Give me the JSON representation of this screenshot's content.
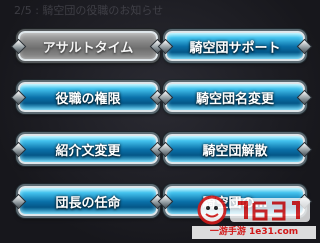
{
  "background_text": "2/5 : 騎空団の役職のお知らせ",
  "buttons": [
    {
      "label": "アサルトタイム",
      "style": "gray"
    },
    {
      "label": "騎空団サポート",
      "style": "blue"
    },
    {
      "label": "役職の権限",
      "style": "blue"
    },
    {
      "label": "騎空団名変更",
      "style": "blue"
    },
    {
      "label": "紹介文変更",
      "style": "blue"
    },
    {
      "label": "騎空団解散",
      "style": "blue"
    },
    {
      "label": "団長の任命",
      "style": "blue"
    },
    {
      "label": "騎空団の…",
      "style": "blue"
    }
  ],
  "watermark": {
    "logo": "1631",
    "url": "一游手游 1e31.com"
  },
  "colors": {
    "accent_blue": "#0a71a9",
    "button_gray": "#8a8a8a",
    "watermark_red": "#d21818"
  }
}
